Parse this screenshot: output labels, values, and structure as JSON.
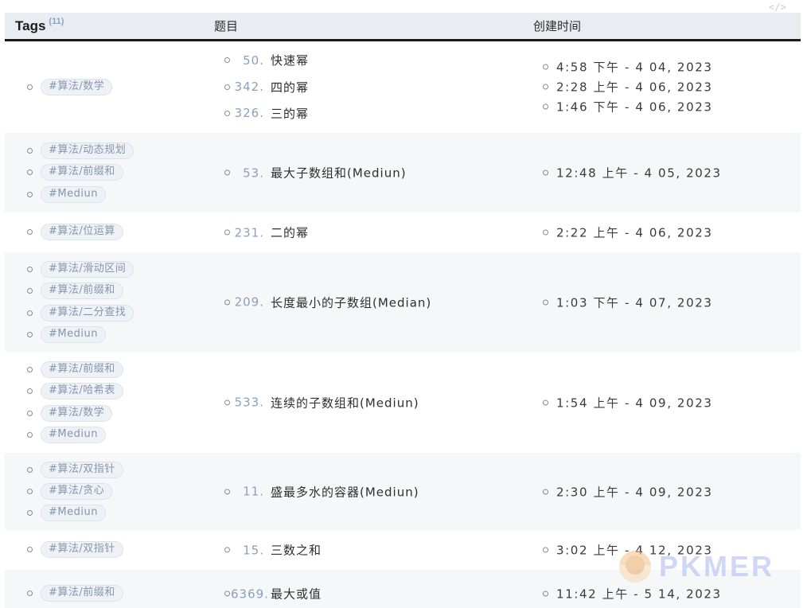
{
  "header": {
    "tags_label": "Tags",
    "tags_count": "(11)",
    "title_label": "题目",
    "time_label": "创建时间",
    "code_icon_glyph": "</>"
  },
  "rows": [
    {
      "tags": [
        "#算法/数学"
      ],
      "titles": [
        {
          "num": "50.",
          "text": "快速幂"
        },
        {
          "num": "342.",
          "text": "四的幂"
        },
        {
          "num": "326.",
          "text": "三的幂"
        }
      ],
      "times": [
        "4:58 下午 - 4 04, 2023",
        "2:28 上午 - 4 06, 2023",
        "1:46 下午 - 4 06, 2023"
      ]
    },
    {
      "tags": [
        "#算法/动态规划",
        "#算法/前缀和",
        "#Mediun"
      ],
      "titles": [
        {
          "num": "53.",
          "text": "最大子数组和(Mediun)"
        }
      ],
      "times": [
        "12:48 上午 - 4 05, 2023"
      ]
    },
    {
      "tags": [
        "#算法/位运算"
      ],
      "titles": [
        {
          "num": "231.",
          "text": "二的幂"
        }
      ],
      "times": [
        "2:22 上午 - 4 06, 2023"
      ]
    },
    {
      "tags": [
        "#算法/滑动区间",
        "#算法/前缀和",
        "#算法/二分查找",
        "#Mediun"
      ],
      "titles": [
        {
          "num": "209.",
          "text": "长度最小的子数组(Median)"
        }
      ],
      "times": [
        "1:03 下午 - 4 07, 2023"
      ]
    },
    {
      "tags": [
        "#算法/前缀和",
        "#算法/哈希表",
        "#算法/数学",
        "#Mediun"
      ],
      "titles": [
        {
          "num": "533.",
          "text": "连续的子数组和(Mediun)"
        }
      ],
      "times": [
        "1:54 上午 - 4 09, 2023"
      ]
    },
    {
      "tags": [
        "#算法/双指针",
        "#算法/贪心",
        "#Mediun"
      ],
      "titles": [
        {
          "num": "11.",
          "text": "盛最多水的容器(Mediun)"
        }
      ],
      "times": [
        "2:30 上午 - 4 09, 2023"
      ]
    },
    {
      "tags": [
        "#算法/双指针"
      ],
      "titles": [
        {
          "num": "15.",
          "text": "三数之和"
        }
      ],
      "times": [
        "3:02 上午 - 4 12, 2023"
      ]
    },
    {
      "tags": [
        "#算法/前缀和"
      ],
      "titles": [
        {
          "num": "6369.",
          "text": "最大或值"
        }
      ],
      "times": [
        "11:42 上午 - 5 14, 2023"
      ]
    }
  ],
  "watermark": {
    "text": "PKMER",
    "logo_icon": "pkmer-logo-icon",
    "color": "#a8b8ee"
  }
}
